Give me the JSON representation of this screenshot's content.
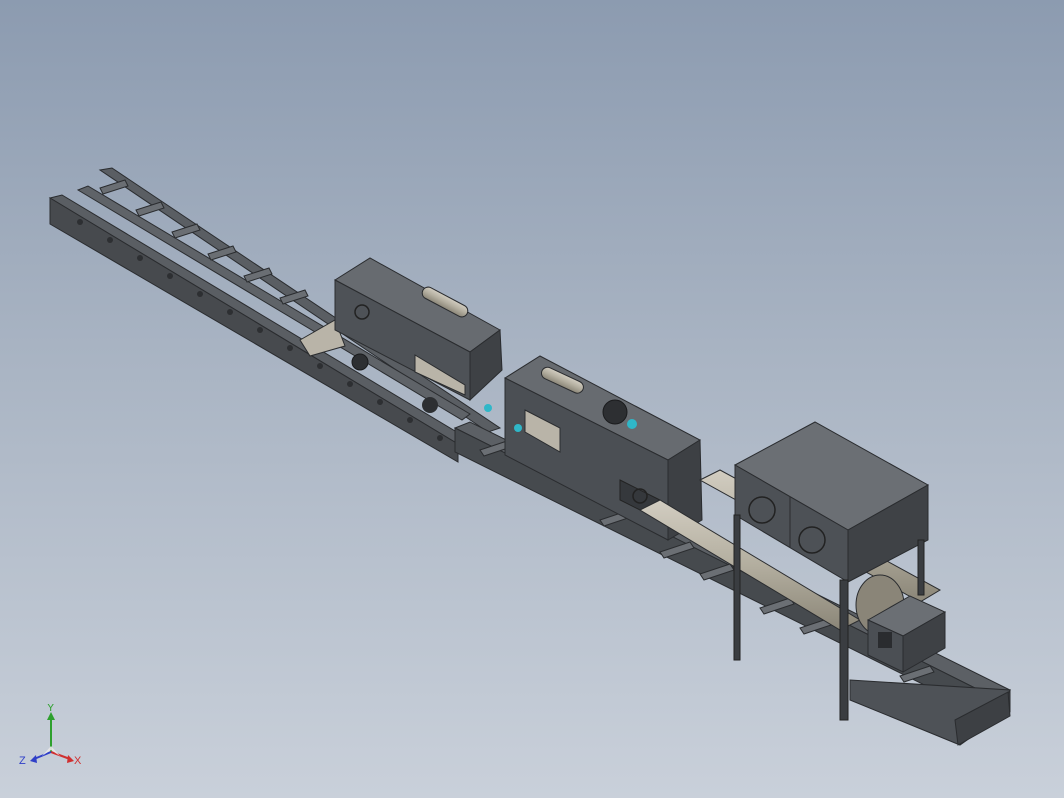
{
  "triad": {
    "x_label": "X",
    "y_label": "Y",
    "z_label": "Z",
    "x_color": "#d03030",
    "y_color": "#2ea02e",
    "z_color": "#2f3fc8"
  },
  "colors": {
    "background_top": "#8c9bb0",
    "background_bottom": "#c9d0da",
    "steel": "#4d5054",
    "steel_dark": "#34373b",
    "steel_light": "#6a6e73",
    "tube": "#b9b4a8",
    "accent_cyan": "#2fb7c8"
  },
  "model": {
    "name_icon": "conveyor-machine-assembly"
  }
}
